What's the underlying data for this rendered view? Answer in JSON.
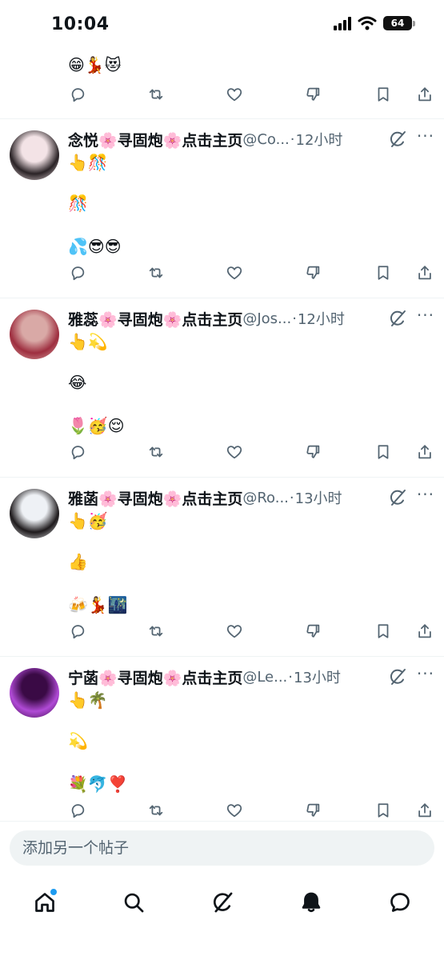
{
  "status_bar": {
    "time": "10:04",
    "battery": "64"
  },
  "previous_post": {
    "emoji_line": "😁💃😻"
  },
  "posts": [
    {
      "name": "念悦🌸寻固炮🌸点击主页",
      "handle": "@Co...",
      "separator": "·",
      "time": "12小时",
      "lines": [
        "👆🎊",
        "🎊",
        "💦😎😎"
      ],
      "avatar_colors": [
        "#f3e3e6",
        "#2a2326"
      ]
    },
    {
      "name": "雅蕊🌸寻固炮🌸点击主页",
      "handle": "@Jos...",
      "separator": "·",
      "time": "12小时",
      "lines": [
        "👆💫",
        "😂",
        "🌷🥳😌"
      ],
      "avatar_colors": [
        "#d9a9a6",
        "#9e2e3f"
      ]
    },
    {
      "name": "雅菡🌸寻固炮🌸点击主页",
      "handle": "@Ro...",
      "separator": "·",
      "time": "13小时",
      "lines": [
        "👆🥳",
        "👍",
        "🍻💃🌃"
      ],
      "avatar_colors": [
        "#eef1f5",
        "#1e1a1c"
      ]
    },
    {
      "name": "宁菡🌸寻固炮🌸点击主页",
      "handle": "@Le...",
      "separator": "·",
      "time": "13小时",
      "lines": [
        "👆🌴",
        "💫",
        "💐🐬❣️"
      ],
      "avatar_colors": [
        "#3a0a45",
        "#b04ad6"
      ]
    }
  ],
  "compose": {
    "placeholder": "添加另一个帖子"
  },
  "icons": {
    "actions": [
      "reply-icon",
      "repost-icon",
      "like-icon",
      "dislike-icon",
      "bookmark-icon",
      "share-icon"
    ],
    "tabs": [
      "home-icon",
      "search-icon",
      "grok-icon",
      "notifications-icon",
      "messages-icon"
    ]
  },
  "colors": {
    "icon_gray": "#536471",
    "text": "#0f1419",
    "accent_blue": "#1d9bf0",
    "divider": "#eff3f4",
    "compose_bg": "#eff3f4"
  }
}
